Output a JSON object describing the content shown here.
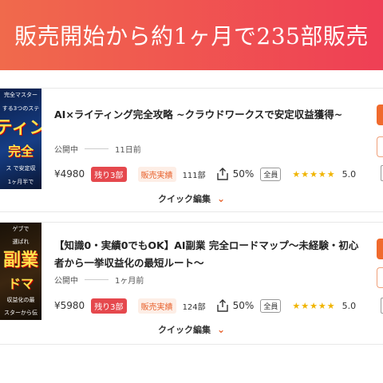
{
  "banner": {
    "title": "販売開始から約1ヶ月で235部販売"
  },
  "listings": [
    {
      "thumbnail": {
        "line1": "完全マスター",
        "line2": "する3つのステ",
        "big": "ティン",
        "line3": "完全",
        "line4": "ス で安定収",
        "line5": "1ヶ月半で"
      },
      "title": "AI×ライティング完全攻略 ~クラウドワークスで安定収益獲得~",
      "status": "公開中",
      "published": "11日前",
      "price": "¥4980",
      "stock_badge": "残り3部",
      "sales_badge": "販売実績",
      "sales_count": "111部",
      "percent": "50%",
      "scope": "全員",
      "stars": "★★★★★",
      "rating": "5.0",
      "quick_edit": "クイック編集"
    },
    {
      "thumbnail": {
        "line1": "ゲブで",
        "line2": "選ばれ",
        "big": "副業",
        "line3": "ドマ",
        "line4": "収益化の最",
        "line5": "スターから伝"
      },
      "title": "【知識0・実績0でもOK】AI副業 完全ロードマップ～未経験・初心者から一挙収益化の最短ルート～",
      "status": "公開中",
      "published": "1ヶ月前",
      "price": "¥5980",
      "stock_badge": "残り3部",
      "sales_badge": "販売実績",
      "sales_count": "124部",
      "percent": "50%",
      "scope": "全員",
      "stars": "★★★★★",
      "rating": "5.0",
      "quick_edit": "クイック編集"
    }
  ],
  "icons": {
    "share": "share-icon",
    "expand": "chevron-down-icon"
  },
  "colors": {
    "banner_start": "#f06a4c",
    "banner_end": "#ef3f55",
    "accent": "#e8622d",
    "stock_red": "#e5484d",
    "star": "#f0b400"
  }
}
